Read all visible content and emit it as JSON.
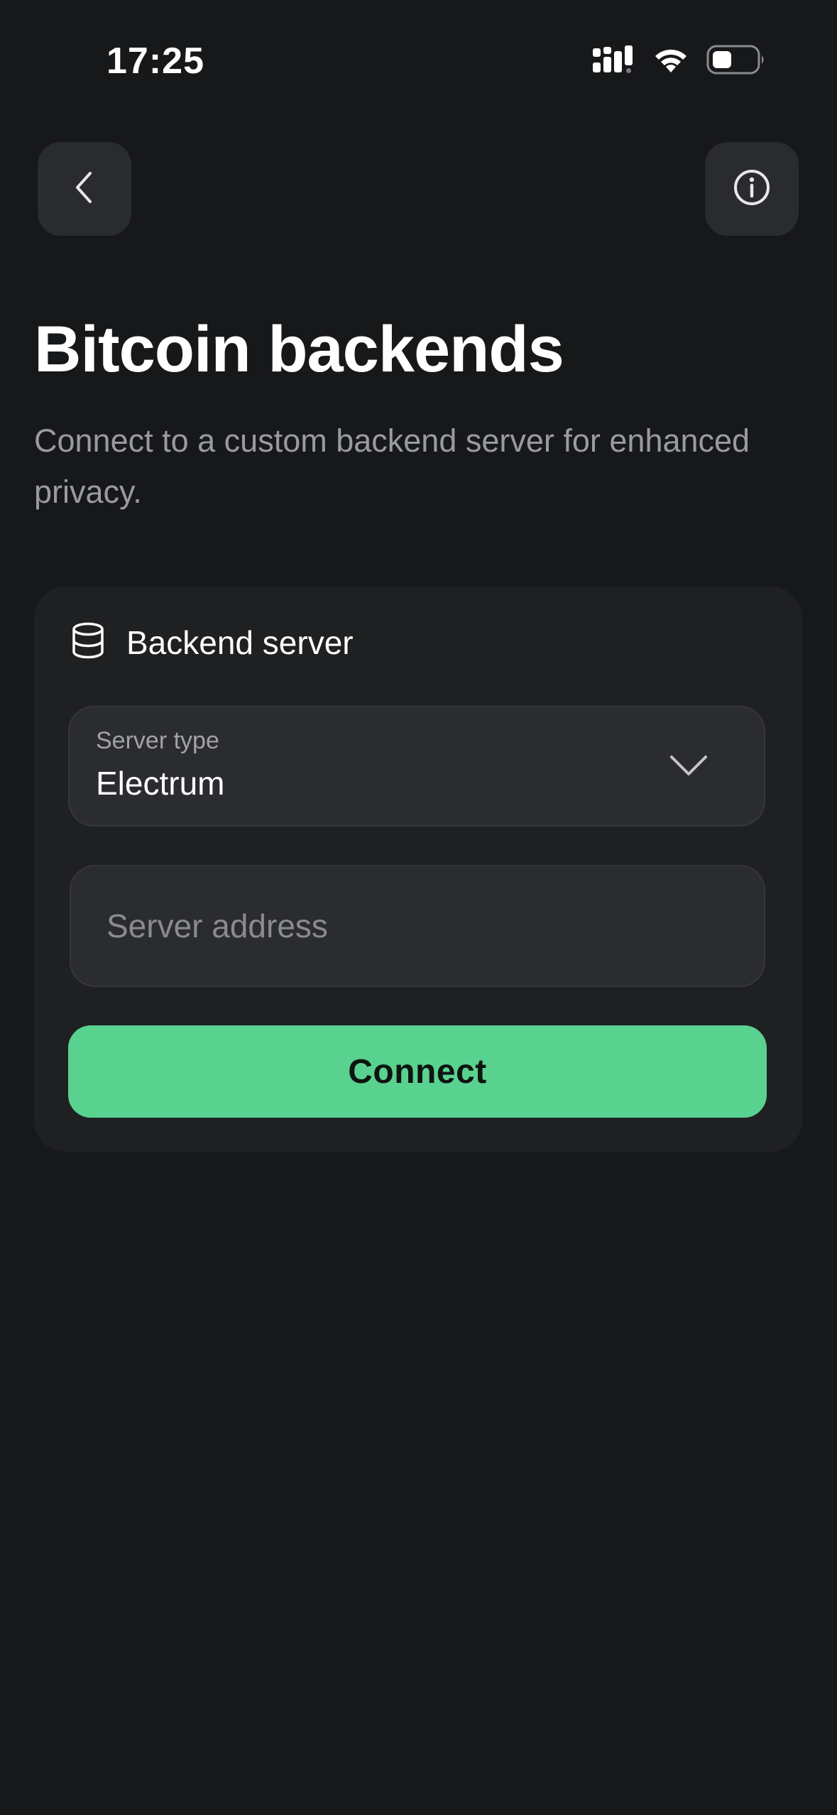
{
  "status_bar": {
    "time": "17:25",
    "icons": [
      "cellular-signal-icon",
      "wifi-icon",
      "battery-icon"
    ]
  },
  "nav": {
    "back_icon": "chevron-left-icon",
    "info_icon": "info-icon"
  },
  "header": {
    "title": "Bitcoin backends",
    "subtitle": "Connect to a custom backend server for enhanced privacy."
  },
  "card": {
    "icon": "database-icon",
    "title": "Backend server",
    "server_type": {
      "label": "Server type",
      "value": "Electrum"
    },
    "server_address": {
      "value": "",
      "placeholder": "Server address"
    },
    "connect_label": "Connect"
  },
  "colors": {
    "background": "#17181a",
    "card": "#1f2022",
    "field": "#2b2c30",
    "accent": "#5ad28f",
    "muted_text": "#9a9ba1"
  }
}
